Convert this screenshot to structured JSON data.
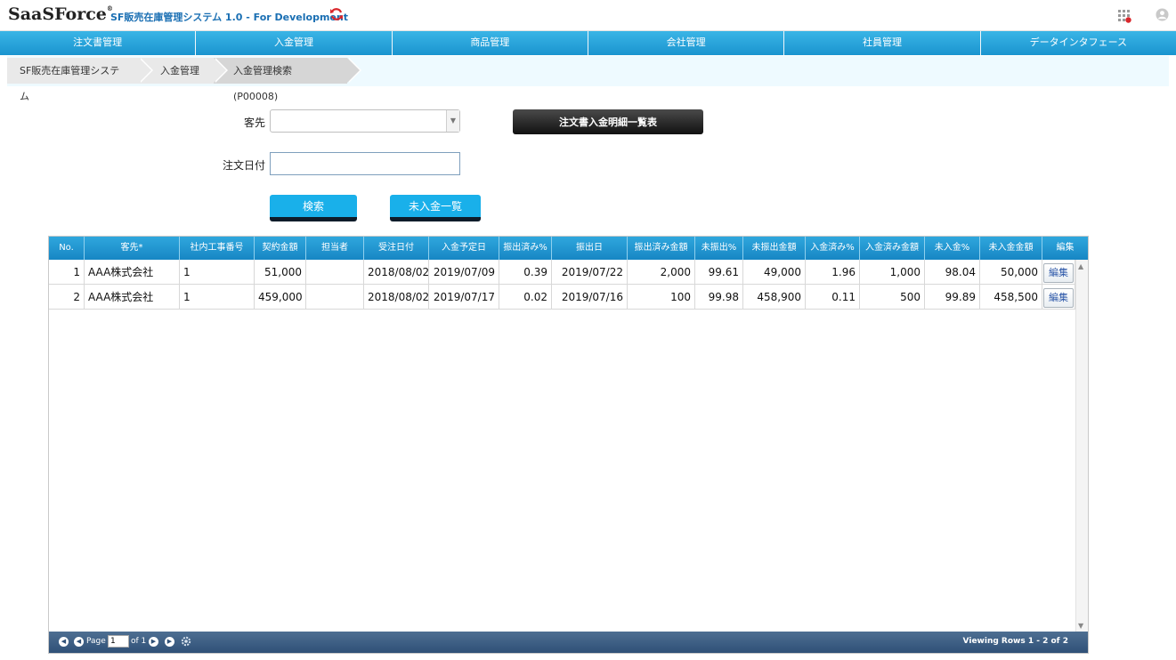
{
  "header": {
    "logo_text": "SaaSForce",
    "logo_mark": "®",
    "app_title": "SF販売在庫管理システム 1.0 - For Development"
  },
  "nav": [
    "注文書管理",
    "入金管理",
    "商品管理",
    "会社管理",
    "社員管理",
    "データインタフェース"
  ],
  "breadcrumb": [
    "SF販売在庫管理システム",
    "入金管理",
    "入金管理検索(P00008)"
  ],
  "form": {
    "customer_label": "客先",
    "customer_value": "",
    "order_date_label": "注文日付",
    "order_date_value": "",
    "detail_button": "注文書入金明細一覧表",
    "search_button": "検索",
    "unpaid_button": "未入金一覧"
  },
  "table": {
    "columns": [
      "No.",
      "客先*",
      "社内工事番号",
      "契約金額",
      "担当者",
      "受注日付",
      "入金予定日",
      "振出済み%",
      "振出日",
      "振出済み金額",
      "未振出%",
      "未振出金額",
      "入金済み%",
      "入金済み金額",
      "未入金%",
      "未入金金額",
      "編集"
    ],
    "rows": [
      [
        "1",
        "AAA株式会社",
        "1",
        "51,000",
        "",
        "2018/08/02",
        "2019/07/09",
        "0.39",
        "2019/07/22",
        "2,000",
        "99.61",
        "49,000",
        "1.96",
        "1,000",
        "98.04",
        "50,000",
        "編集"
      ],
      [
        "2",
        "AAA株式会社",
        "1",
        "459,000",
        "",
        "2018/08/02",
        "2019/07/17",
        "0.02",
        "2019/07/16",
        "100",
        "99.98",
        "458,900",
        "0.11",
        "500",
        "99.89",
        "458,500",
        "編集"
      ]
    ]
  },
  "pager": {
    "page_label": "Page",
    "page_value": "1",
    "of_label": "of 1",
    "viewing": "Viewing Rows 1 - 2 of 2"
  },
  "colors": {
    "nav_blue": "#1a94cf",
    "button_blue": "#19b0ea",
    "pager_blue": "#2f5077",
    "refresh_red": "#d9262b"
  },
  "icons": [
    "refresh-icon",
    "apps-grid-icon",
    "user-icon",
    "dropdown-arrow-icon",
    "first-page-icon",
    "prev-page-icon",
    "next-page-icon",
    "last-page-icon",
    "gear-icon"
  ]
}
